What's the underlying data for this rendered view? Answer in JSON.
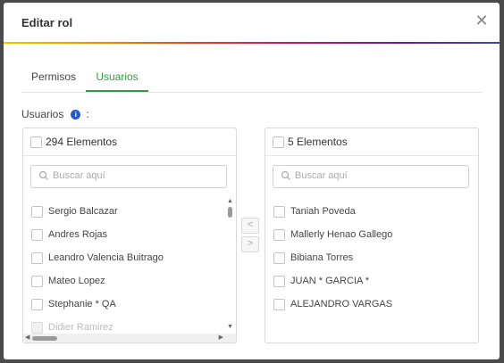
{
  "modal": {
    "title": "Editar rol",
    "close_glyph": "✕"
  },
  "tabs": [
    {
      "label": "Permisos",
      "active": false
    },
    {
      "label": "Usuarios",
      "active": true
    }
  ],
  "section": {
    "label": "Usuarios",
    "info_glyph": "i",
    "colon": ":"
  },
  "left_panel": {
    "count_label": "294 Elementos",
    "search_placeholder": "Buscar aquí",
    "items": [
      {
        "label": "Sergio Balcazar",
        "disabled": false
      },
      {
        "label": "Andres Rojas",
        "disabled": false
      },
      {
        "label": "Leandro Valencia Buitrago",
        "disabled": false
      },
      {
        "label": "Mateo Lopez",
        "disabled": false
      },
      {
        "label": "Stephanie * QA",
        "disabled": false
      },
      {
        "label": "Didier Ramirez",
        "disabled": true
      }
    ]
  },
  "right_panel": {
    "count_label": "5 Elementos",
    "search_placeholder": "Buscar aquí",
    "items": [
      {
        "label": "Taniah Poveda",
        "disabled": false
      },
      {
        "label": "Mallerly Henao Gallego",
        "disabled": false
      },
      {
        "label": "Bibiana Torres",
        "disabled": false
      },
      {
        "label": "JUAN * GARCIA *",
        "disabled": false
      },
      {
        "label": "ALEJANDRO VARGAS",
        "disabled": false
      }
    ]
  },
  "transfer": {
    "left_glyph": "<",
    "right_glyph": ">"
  },
  "colors": {
    "accent": "#2e9e3e",
    "info": "#1e5bd8"
  },
  "icons": [
    "close-icon",
    "info-icon",
    "search-icon",
    "chevron-left-icon",
    "chevron-right-icon"
  ]
}
